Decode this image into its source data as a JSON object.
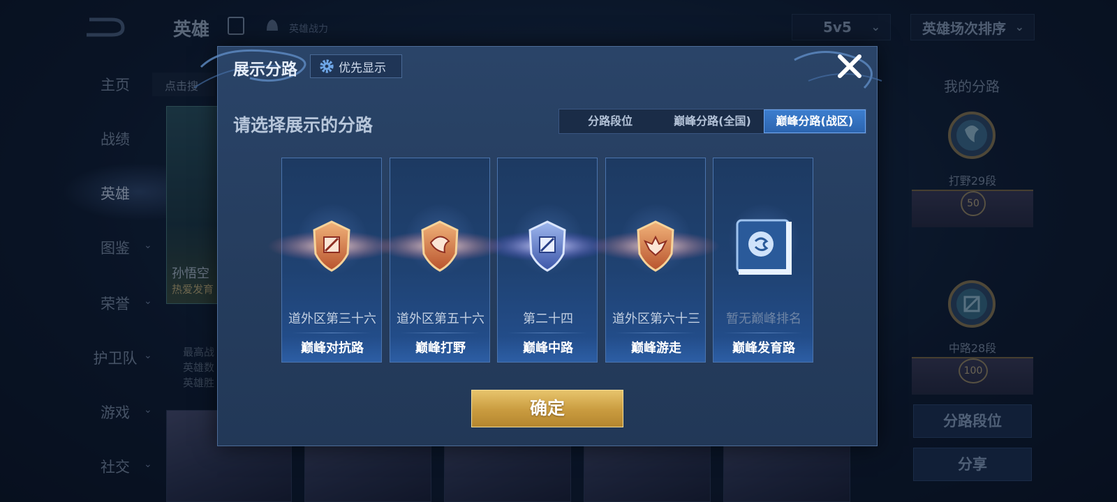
{
  "background": {
    "top_title": "英雄",
    "top_power_label": "英雄战力",
    "mode_dropdown": "5v5",
    "sort_dropdown": "英雄场次排序",
    "search_hint": "点击搜",
    "nav": [
      "主页",
      "战绩",
      "英雄",
      "图鉴",
      "荣誉",
      "护卫队",
      "游戏",
      "社交"
    ],
    "active_nav": "英雄",
    "hero_card_name": "孙悟空",
    "hero_card_tag": "热爱发育",
    "info_lines": [
      "最高战",
      "英雄数",
      "英雄胜"
    ],
    "my_lanes_title": "我的分路",
    "rank1_label": "打野29段",
    "rank1_plate": "50",
    "rank2_label": "中路28段",
    "rank2_plate": "100",
    "btn_lane_rank": "分路段位",
    "btn_share": "分享"
  },
  "modal": {
    "title": "展示分路",
    "priority_button": "优先显示",
    "subtitle": "请选择展示的分路",
    "tabs": [
      "分路段位",
      "巅峰分路(全国)",
      "巅峰分路(战区)"
    ],
    "active_tab": 2,
    "cards": [
      {
        "rank": "道外区第三十六",
        "role": "巅峰对抗路",
        "badge": "shield-sword",
        "color": "#c96a3c"
      },
      {
        "rank": "道外区第五十六",
        "role": "巅峰打野",
        "badge": "shield-dragon",
        "color": "#c96a3c"
      },
      {
        "rank": "第二十四",
        "role": "巅峰中路",
        "badge": "shield-mid",
        "color": "#4f76c9"
      },
      {
        "rank": "道外区第六十三",
        "role": "巅峰游走",
        "badge": "shield-wings",
        "color": "#c96a3c"
      },
      {
        "rank": "暂无巅峰排名",
        "role": "巅峰发育路",
        "badge": "adc-emblem",
        "color": "#9fc3ee"
      }
    ],
    "confirm_button": "确定"
  }
}
